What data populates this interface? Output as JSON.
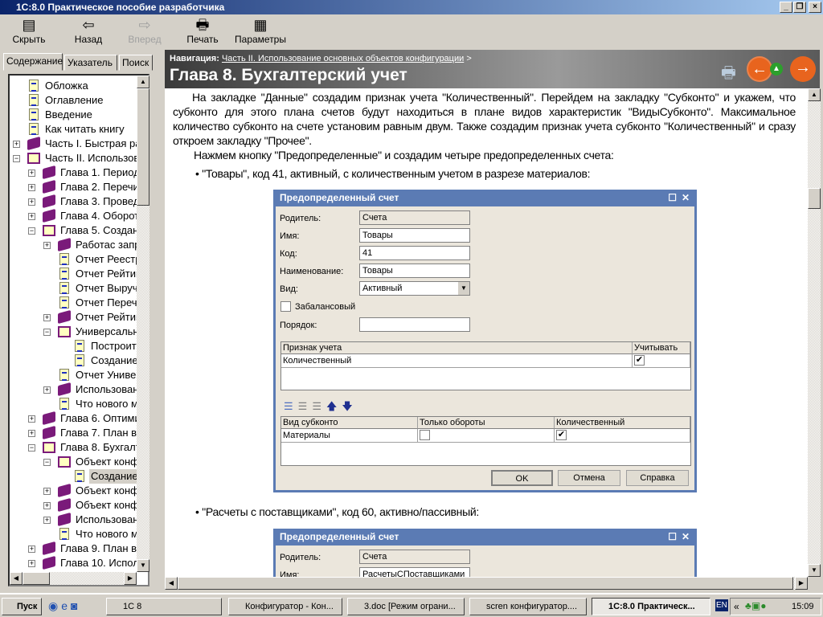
{
  "window": {
    "title": "1С:8.0  Практическое пособие разработчика"
  },
  "toolbar": {
    "hide": "Скрыть",
    "back": "Назад",
    "forward": "Вперед",
    "print": "Печать",
    "params": "Параметры"
  },
  "tabs": [
    "Содержание",
    "Указатель",
    "Поиск"
  ],
  "tree": [
    {
      "t": "Обложка",
      "l": 0,
      "k": "doc"
    },
    {
      "t": "Оглавление",
      "l": 0,
      "k": "doc"
    },
    {
      "t": "Введение",
      "l": 0,
      "k": "doc"
    },
    {
      "t": "Как читать книгу",
      "l": 0,
      "k": "doc"
    },
    {
      "t": "Часть I. Быстрая ра",
      "l": 0,
      "k": "book",
      "e": "+"
    },
    {
      "t": "Часть II. Использов",
      "l": 0,
      "k": "obook",
      "e": "-"
    },
    {
      "t": "Глава 1. Период",
      "l": 1,
      "k": "book",
      "e": "+"
    },
    {
      "t": "Глава 2. Перечи",
      "l": 1,
      "k": "book",
      "e": "+"
    },
    {
      "t": "Глава 3. Провед",
      "l": 1,
      "k": "book",
      "e": "+"
    },
    {
      "t": "Глава 4. Оборот",
      "l": 1,
      "k": "book",
      "e": "+"
    },
    {
      "t": "Глава 5. Создан",
      "l": 1,
      "k": "obook",
      "e": "-"
    },
    {
      "t": "Работас запр",
      "l": 2,
      "k": "book",
      "e": "+"
    },
    {
      "t": "Отчет Реестр",
      "l": 2,
      "k": "doc"
    },
    {
      "t": "Отчет Рейтин",
      "l": 2,
      "k": "doc"
    },
    {
      "t": "Отчет Выручк",
      "l": 2,
      "k": "doc"
    },
    {
      "t": "Отчет Перече",
      "l": 2,
      "k": "doc"
    },
    {
      "t": "Отчет Рейтин",
      "l": 2,
      "k": "book",
      "e": "+"
    },
    {
      "t": "Универсальн",
      "l": 2,
      "k": "obook",
      "e": "-"
    },
    {
      "t": "Построите",
      "l": 3,
      "k": "doc"
    },
    {
      "t": "Создание",
      "l": 3,
      "k": "doc"
    },
    {
      "t": "Отчет Универ",
      "l": 2,
      "k": "doc"
    },
    {
      "t": "Использовани",
      "l": 2,
      "k": "book",
      "e": "+"
    },
    {
      "t": "Что нового м",
      "l": 2,
      "k": "doc"
    },
    {
      "t": "Глава 6. Оптими",
      "l": 1,
      "k": "book",
      "e": "+"
    },
    {
      "t": "Глава 7. План ви",
      "l": 1,
      "k": "book",
      "e": "+"
    },
    {
      "t": "Глава 8. Бухгалт",
      "l": 1,
      "k": "obook",
      "e": "-"
    },
    {
      "t": "Объект конфи",
      "l": 2,
      "k": "obook",
      "e": "-"
    },
    {
      "t": "Создание",
      "l": 3,
      "k": "doc",
      "sel": true
    },
    {
      "t": "Объект конфи",
      "l": 2,
      "k": "book",
      "e": "+"
    },
    {
      "t": "Объект конфи",
      "l": 2,
      "k": "book",
      "e": "+"
    },
    {
      "t": "Использовани",
      "l": 2,
      "k": "book",
      "e": "+"
    },
    {
      "t": "Что нового м",
      "l": 2,
      "k": "doc"
    },
    {
      "t": "Глава 9. План ви",
      "l": 1,
      "k": "book",
      "e": "+"
    },
    {
      "t": "Глава 10. Испол",
      "l": 1,
      "k": "book",
      "e": "+"
    }
  ],
  "header": {
    "nav_label": "Навигация:",
    "nav_link": "Часть II. Использование основных объектов конфигурации",
    "nav_sep": ">",
    "title": "Глава 8. Бухгалтерский учет"
  },
  "content": {
    "p1": "На закладке \"Данные\" создадим признак учета \"Количественный\". Перейдем на закладку \"Субконто\" и укажем, что субконто для этого плана счетов будут находиться в плане видов характеристик \"ВидыСубконто\". Максимальное количество субконто на счете установим равным двум. Также создадим признак учета субконто \"Количественный\" и сразу откроем закладку \"Прочее\".",
    "p2": "Нажмем кнопку \"Предопределенные\" и создадим четыре предопределенных счета:",
    "b1": "\"Товары\", код 41, активный, с количественным учетом в разрезе материалов:",
    "b2": "\"Расчеты с поставщиками\", код 60, активно/пассивный:"
  },
  "dialog1": {
    "title": "Предопределенный счет",
    "parent_label": "Родитель:",
    "parent": "Счета",
    "name_label": "Имя:",
    "name": "Товары",
    "code_label": "Код:",
    "code": "41",
    "desc_label": "Наименование:",
    "desc": "Товары",
    "kind_label": "Вид:",
    "kind": "Активный",
    "offbalance_label": "Забалансовый",
    "order_label": "Порядок:",
    "order": "",
    "flags_cols": [
      "Признак учета",
      "Учитывать"
    ],
    "flags_rows": [
      {
        "name": "Количественный",
        "checked": true
      }
    ],
    "sub_cols": [
      "Вид субконто",
      "Только обороты",
      "Количественный"
    ],
    "sub_rows": [
      {
        "name": "Материалы",
        "turnover": false,
        "qty": true
      }
    ],
    "ok": "OK",
    "cancel": "Отмена",
    "help": "Справка"
  },
  "dialog2": {
    "title": "Предопределенный счет",
    "parent_label": "Родитель:",
    "parent": "Счета",
    "name_label": "Имя:",
    "name": "РасчетыСПоставщиками"
  },
  "taskbar": {
    "start": "Пуск",
    "tasks": [
      "1С 8",
      "Конфигуратор - Кон...",
      "3.doc [Режим ограни...",
      "scren конфигуратор....",
      "1С:8.0  Практическ..."
    ],
    "lang": "EN",
    "clock": "15:09"
  }
}
